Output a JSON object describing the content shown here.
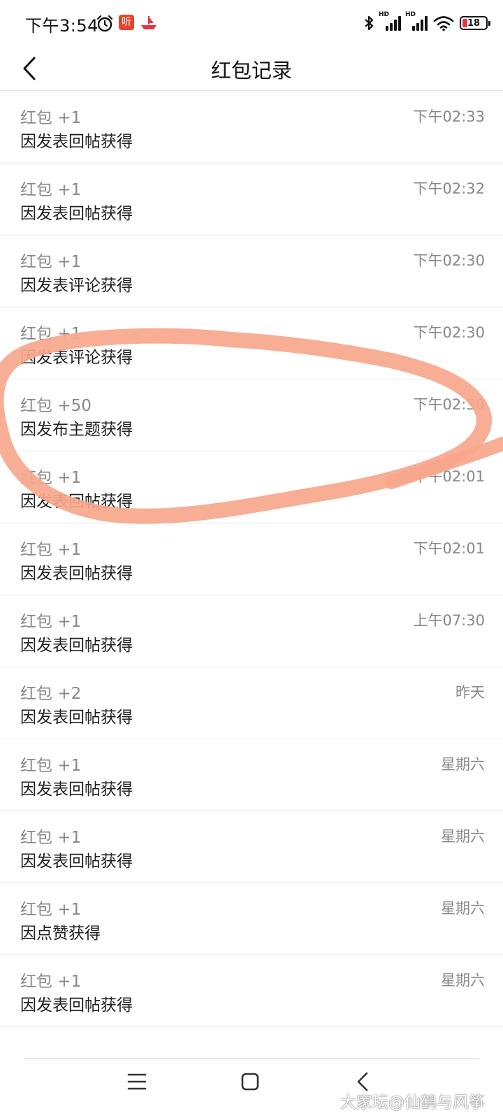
{
  "status_bar": {
    "time": "下午3:54",
    "ting_badge": "听",
    "hd_label": "HD",
    "battery_level": "18"
  },
  "header": {
    "title": "红包记录"
  },
  "records": [
    {
      "amount": "红包 +1",
      "reason": "因发表回帖获得",
      "time": "下午02:33"
    },
    {
      "amount": "红包 +1",
      "reason": "因发表回帖获得",
      "time": "下午02:32"
    },
    {
      "amount": "红包 +1",
      "reason": "因发表评论获得",
      "time": "下午02:30"
    },
    {
      "amount": "红包 +1",
      "reason": "因发表评论获得",
      "time": "下午02:30"
    },
    {
      "amount": "红包 +50",
      "reason": "因发布主题获得",
      "time": "下午02:30"
    },
    {
      "amount": "红包 +1",
      "reason": "因发表回帖获得",
      "time": "下午02:01"
    },
    {
      "amount": "红包 +1",
      "reason": "因发表回帖获得",
      "time": "下午02:01"
    },
    {
      "amount": "红包 +1",
      "reason": "因发表回帖获得",
      "time": "上午07:30"
    },
    {
      "amount": "红包 +2",
      "reason": "因发表回帖获得",
      "time": "昨天"
    },
    {
      "amount": "红包 +1",
      "reason": "因发表回帖获得",
      "time": "星期六"
    },
    {
      "amount": "红包 +1",
      "reason": "因发表回帖获得",
      "time": "星期六"
    },
    {
      "amount": "红包 +1",
      "reason": "因点赞获得",
      "time": "星期六"
    },
    {
      "amount": "红包 +1",
      "reason": "因发表回帖获得",
      "time": "星期六"
    }
  ],
  "watermark": "大家坛@仙鹤与风筝",
  "colors": {
    "annotation_stroke": "#f7a68c",
    "battery_low": "#e0393e",
    "ting_badge": "#e8432a"
  },
  "icons": {
    "back": "chevron-left-icon",
    "alarm": "alarm-clock-icon",
    "bluetooth": "bluetooth-icon",
    "wifi": "wifi-icon",
    "nav_menu": "menu-icon",
    "nav_home": "home-square-icon",
    "nav_back": "back-chevron-icon"
  }
}
